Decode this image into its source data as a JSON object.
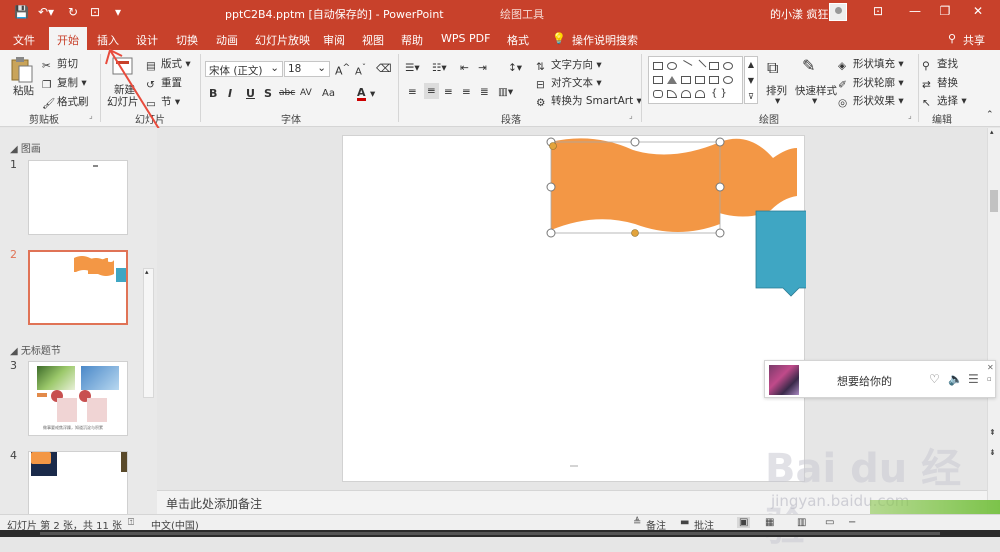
{
  "titlebar": {
    "title": "pptC2B4.pptm [自动保存的] - PowerPoint",
    "context_tab": "绘图工具",
    "user": "的小漾 疯狂",
    "min": "—",
    "restore": "❐",
    "close": "✕",
    "ribbon_opts": "⊡"
  },
  "tabs": [
    "文件",
    "开始",
    "插入",
    "设计",
    "切换",
    "动画",
    "幻灯片放映",
    "审阅",
    "视图",
    "帮助",
    "WPS PDF",
    "格式"
  ],
  "active_tab": "开始",
  "tell_me": "操作说明搜索",
  "share": "共享",
  "ribbon": {
    "clipboard": {
      "label": "剪贴板",
      "paste": "粘贴",
      "cut": "剪切",
      "copy": "复制",
      "format_painter": "格式刷"
    },
    "slides": {
      "label": "幻灯片",
      "new_slide": "新建",
      "new_slide2": "幻灯片",
      "layout": "版式",
      "reset": "重置",
      "section": "节"
    },
    "font": {
      "label": "字体",
      "font_name": "宋体 (正文)",
      "font_size": "18",
      "bold": "B",
      "italic": "I",
      "underline": "U",
      "shadow": "S",
      "strike": "abc",
      "spacing": "AV",
      "case": "Aa",
      "color": "A"
    },
    "paragraph": {
      "label": "段落",
      "text_direction": "文字方向",
      "align_text": "对齐文本",
      "smartart": "转换为 SmartArt"
    },
    "drawing": {
      "label": "绘图",
      "arrange": "排列",
      "quick_styles": "快速样式",
      "fill": "形状填充",
      "outline": "形状轮廓",
      "effects": "形状效果"
    },
    "editing": {
      "label": "编辑",
      "find": "查找",
      "replace": "替换",
      "select": "选择"
    }
  },
  "left_panel": {
    "section1": "图画",
    "section2": "无标题节",
    "slides": [
      "1",
      "2",
      "3",
      "4"
    ],
    "thumb3_caption": "做事要戒焦浮躁，知道沉淀与积累"
  },
  "notes_placeholder": "单击此处添加备注",
  "popup": {
    "song": "想要给你的"
  },
  "watermark": {
    "line1": "Bai du 经验",
    "line2": "jingyan.baidu.com"
  },
  "status": {
    "slide_info": "幻灯片 第 2 张，共 11 张",
    "language": "中文(中国)",
    "notes": "备注",
    "comments": "批注"
  },
  "colors": {
    "accent": "#c8412b",
    "orange_shape": "#f39745",
    "blue_shape": "#3fa6c3"
  }
}
